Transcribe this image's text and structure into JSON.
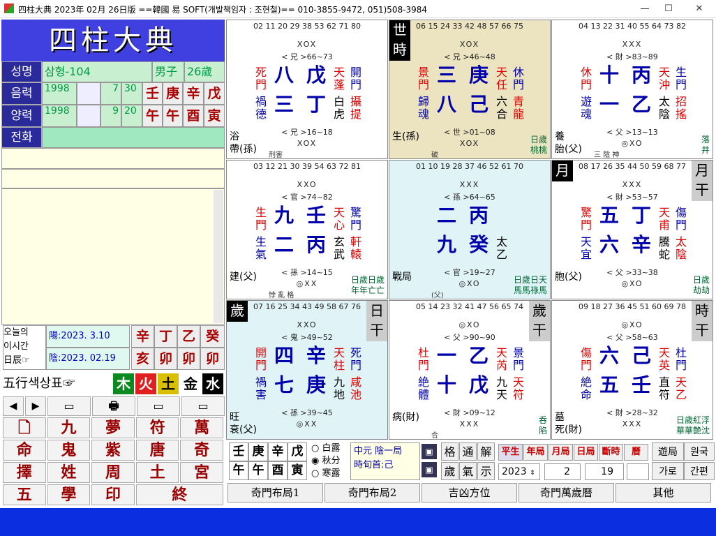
{
  "window": {
    "title": "四柱大典 2023年 02月 26日版 ==韓國 易 SOFT(개발책임자 : 조현철)== 010-3855-9472, 051)508-3984",
    "min": "—",
    "max": "☐",
    "close": "✕"
  },
  "logo": "四柱大典",
  "profile": {
    "name_label": "성명",
    "name": "삼형-104",
    "gender": "男子",
    "age": "26歲",
    "lunar_label": "음력",
    "lunar_year": "1998",
    "lunar_month": "7",
    "lunar_day": "30",
    "solar_label": "양력",
    "solar_year": "1998",
    "solar_month": "9",
    "solar_day": "20",
    "phone_label": "전화",
    "stems": [
      "壬",
      "庚",
      "辛",
      "戊"
    ],
    "branches": [
      "午",
      "午",
      "酉",
      "寅"
    ]
  },
  "today": {
    "label": "오늘의\n이시간\n日辰☞",
    "yang": "陽:2023.  3.10",
    "eum": "陰:2023.  02.19",
    "stems": [
      "辛",
      "丁",
      "乙",
      "癸"
    ],
    "branches": [
      "亥",
      "卯",
      "卯",
      "卯"
    ]
  },
  "wuxing": {
    "label": "五行색상표☞",
    "items": [
      {
        "t": "木",
        "c": "#0a8a20"
      },
      {
        "t": "火",
        "c": "#e02020"
      },
      {
        "t": "土",
        "c": "#d8c000"
      },
      {
        "t": "金",
        "c": "#fff"
      },
      {
        "t": "水",
        "c": "#000"
      }
    ]
  },
  "tools": [
    "◀",
    "▶",
    "▭",
    "🖶",
    "▭",
    "▭"
  ],
  "menu": [
    [
      "🗋",
      "九",
      "夢",
      "符",
      "萬"
    ],
    [
      "命",
      "鬼",
      "紫",
      "唐",
      "奇"
    ],
    [
      "擇",
      "姓",
      "周",
      "土",
      "宮"
    ],
    [
      "五",
      "學",
      "印",
      "終"
    ]
  ],
  "cells": [
    {
      "nums": "02 11 20 29 38 53 62 71 80",
      "marks": "XOX",
      "rel": "< 兄 >66~73",
      "tl": [
        "死",
        "門"
      ],
      "bl": [
        "禍",
        "德"
      ],
      "m1": "八",
      "m2": "戊",
      "m3": "三",
      "m4": "丁",
      "tr": [
        "天",
        "蓬"
      ],
      "br": [
        "白",
        "虎"
      ],
      "fr": [
        "開",
        "門"
      ],
      "fr2": [
        "攝",
        "提"
      ],
      "low": "< 兄 >16~18",
      "bm": "XOX",
      "corner": "浴\n帶(孫)",
      "note": "刑害",
      "bg": "#fff",
      "side": "",
      "badge": "",
      "badge2": ""
    },
    {
      "nums": "06 15 24 33 42 48 57 66 75",
      "marks": "XOX",
      "rel": "< 兄 >46~48",
      "tl": [
        "景",
        "門"
      ],
      "bl": [
        "歸",
        "魂"
      ],
      "m1": "三",
      "m2": "庚",
      "m3": "八",
      "m4": "己",
      "tr": [
        "天",
        "任"
      ],
      "br": [
        "六",
        "合"
      ],
      "fr": [
        "休",
        "門"
      ],
      "fr2": [
        "青",
        "龍"
      ],
      "low": "< 世 >01~08",
      "bm": "XOX",
      "corner": "生(孫)",
      "note": "破",
      "bg": "#ece4c0",
      "side": "日歲\n桃桃",
      "badge": "世\n時",
      "badge2": ""
    },
    {
      "nums": "04 13 22 31 40 55 64 73 82",
      "marks": "XXX",
      "rel": "< 財 >83~89",
      "tl": [
        "休",
        "門"
      ],
      "bl": [
        "遊",
        "魂"
      ],
      "m1": "十",
      "m2": "丙",
      "m3": "一",
      "m4": "乙",
      "tr": [
        "天",
        "沖"
      ],
      "br": [
        "太",
        "陰"
      ],
      "fr": [
        "生",
        "門"
      ],
      "fr2": [
        "招",
        "搖"
      ],
      "low": "< 父 >13~13",
      "bm": "◎XO",
      "corner": "養\n胎(父)",
      "note": "三 陰 神",
      "bg": "#fff",
      "side": "落\n井",
      "badge": "",
      "badge2": ""
    },
    {
      "nums": "03 12 21 30 39 54 63 72 81",
      "marks": "XXO",
      "rel": "< 官 >74~82",
      "tl": [
        "生",
        "門"
      ],
      "bl": [
        "生",
        "氣"
      ],
      "m1": "九",
      "m2": "壬",
      "m3": "二",
      "m4": "丙",
      "tr": [
        "天",
        "心"
      ],
      "br": [
        "玄",
        "武"
      ],
      "fr": [
        "驚",
        "門"
      ],
      "fr2": [
        "軒",
        "轅"
      ],
      "low": "< 孫 >14~15",
      "bm": "◎XX",
      "corner": "建(父)",
      "note": "悖 亂 格",
      "bg": "#fff",
      "side": "日歲日歲\n年年亡亡",
      "badge": "",
      "badge2": ""
    },
    {
      "nums": "01 10 19 28 37 46 52 61 70",
      "marks": "XXX",
      "rel": "< 孫 >64~65",
      "tl": [
        "",
        ""
      ],
      "bl": [
        "",
        ""
      ],
      "m1": "二",
      "m2": "丙",
      "m3": "九",
      "m4": "癸",
      "tr": [
        "",
        ""
      ],
      "br": [
        "太",
        "乙"
      ],
      "fr": [
        "",
        ""
      ],
      "fr2": [
        "",
        ""
      ],
      "low": "< 官 >19~27",
      "bm": "◎XO",
      "corner": "戰局",
      "note": "(父)",
      "bg": "#e0f4f8",
      "side": "日歲日天\n馬馬祿馬",
      "badge": "",
      "badge2": ""
    },
    {
      "nums": "08 17 26 35 44 50 59 68 77",
      "marks": "XXX",
      "rel": "< 財 >53~57",
      "tl": [
        "驚",
        "門"
      ],
      "bl": [
        "天",
        "宜"
      ],
      "m1": "五",
      "m2": "丁",
      "m3": "六",
      "m4": "辛",
      "tr": [
        "天",
        "甫"
      ],
      "br": [
        "騰",
        "蛇"
      ],
      "fr": [
        "傷",
        "門"
      ],
      "fr2": [
        "太",
        "陰"
      ],
      "low": "< 父 >33~38",
      "bm": "◎XO",
      "corner": "胞(父)",
      "note": "",
      "bg": "#fff",
      "side": "日歲\n劫劫",
      "badge": "月",
      "badge2": "月\n干"
    },
    {
      "nums": "07 16 25 34 43 49 58 67 76",
      "marks": "XXO",
      "rel": "< 鬼 >49~52",
      "tl": [
        "開",
        "門"
      ],
      "bl": [
        "禍",
        "害"
      ],
      "m1": "四",
      "m2": "辛",
      "m3": "七",
      "m4": "庚",
      "tr": [
        "天",
        "柱"
      ],
      "br": [
        "九",
        "地"
      ],
      "fr": [
        "死",
        "門"
      ],
      "fr2": [
        "咸",
        "池"
      ],
      "low": "< 孫 >39~45",
      "bm": "◎XX",
      "corner": "旺\n衰(父)",
      "note": "",
      "bg": "#e0f4f8",
      "side": "",
      "badge": "歲",
      "badge2": "日\n干"
    },
    {
      "nums": "05 14 23 32 41 47 56 65 74",
      "marks": "◎XO",
      "rel": "< 父 >90~90",
      "tl": [
        "杜",
        "門"
      ],
      "bl": [
        "絶",
        "體"
      ],
      "m1": "一",
      "m2": "乙",
      "m3": "十",
      "m4": "戊",
      "tr": [
        "天",
        "芮"
      ],
      "br": [
        "九",
        "天"
      ],
      "fr": [
        "景",
        "門"
      ],
      "fr2": [
        "天",
        "符"
      ],
      "low": "< 財 >09~12",
      "bm": "XXX",
      "corner": "病(財)",
      "note": "合",
      "bg": "#fff",
      "side": "呑\n陷",
      "badge": "",
      "badge2": "歲\n干"
    },
    {
      "nums": "09 18 27 36 45 51 60 69 78",
      "marks": "◎XO",
      "rel": "< 父 >58~63",
      "tl": [
        "傷",
        "門"
      ],
      "bl": [
        "絶",
        "命"
      ],
      "m1": "六",
      "m2": "己",
      "m3": "五",
      "m4": "壬",
      "tr": [
        "天",
        "英"
      ],
      "br": [
        "直",
        "符"
      ],
      "fr": [
        "杜",
        "門"
      ],
      "fr2": [
        "天",
        "乙"
      ],
      "low": "< 財 >28~32",
      "bm": "XXX",
      "corner": "墓\n死(財)",
      "note": "",
      "bg": "#fff",
      "side": "日歲紅浮\n華華艶沈",
      "badge": "",
      "badge2": "時\n干"
    }
  ],
  "bottom": {
    "stems": [
      "壬",
      "庚",
      "辛",
      "戊"
    ],
    "branches": [
      "午",
      "午",
      "酉",
      "寅"
    ],
    "terms": [
      "白露",
      "秋分",
      "寒露"
    ],
    "ju": "中元  陰一局",
    "xun": "時旬首:己",
    "icons": [
      "格",
      "通",
      "解",
      "歲",
      "氣",
      "示"
    ],
    "tabs": [
      "平生",
      "年局",
      "月局",
      "日局",
      "斷時",
      "曆"
    ],
    "year": "2023",
    "month": "2",
    "day": "19",
    "btn1": "遊局",
    "btn2": "원국",
    "btn3": "가로",
    "btn4": "간편"
  },
  "nav": [
    "奇門布局1",
    "奇門布局2",
    "吉凶方位",
    "奇門萬歲曆",
    "其他"
  ]
}
